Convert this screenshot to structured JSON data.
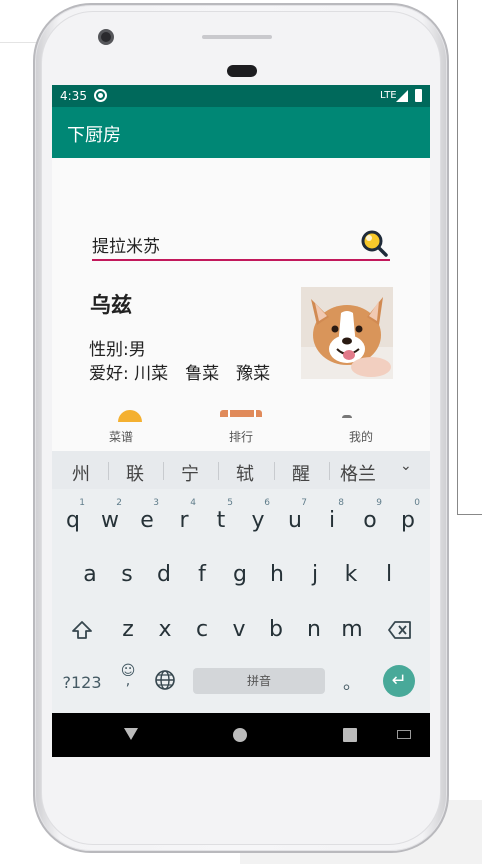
{
  "status_bar": {
    "time": "4:35",
    "network": "LTE"
  },
  "app_bar": {
    "title": "下厨房"
  },
  "search": {
    "value": "提拉米苏",
    "placeholder": ""
  },
  "profile": {
    "name": "乌兹",
    "gender_line": "性别:男",
    "hobby_line": "爱好: 川菜　鲁菜　豫菜"
  },
  "bottom_nav": [
    {
      "label": "菜谱",
      "icon": "recipe-icon"
    },
    {
      "label": "排行",
      "icon": "ranking-icon"
    },
    {
      "label": "我的",
      "icon": "profile-icon"
    }
  ],
  "ime": {
    "candidates": [
      "州",
      "联",
      "宁",
      "轼",
      "醒",
      "格兰"
    ],
    "row1": [
      "q",
      "w",
      "e",
      "r",
      "t",
      "y",
      "u",
      "i",
      "o",
      "p"
    ],
    "row1_hints": [
      "1",
      "2",
      "3",
      "4",
      "5",
      "6",
      "7",
      "8",
      "9",
      "0"
    ],
    "row2": [
      "a",
      "s",
      "d",
      "f",
      "g",
      "h",
      "j",
      "k",
      "l"
    ],
    "row3": [
      "z",
      "x",
      "c",
      "v",
      "b",
      "n",
      "m"
    ],
    "symbols_label": "?123",
    "emoji_label": "☺",
    "comma_label": ",",
    "space_label": "拼音",
    "period_label": "。",
    "shift_icon": "shift-icon",
    "delete_icon": "backspace-icon",
    "enter_icon": "enter-icon",
    "globe_icon": "globe-icon",
    "accent_color": "#48a999"
  },
  "colors": {
    "status_bar": "#00695b",
    "app_bar": "#008775",
    "search_underline": "#c2185b"
  }
}
